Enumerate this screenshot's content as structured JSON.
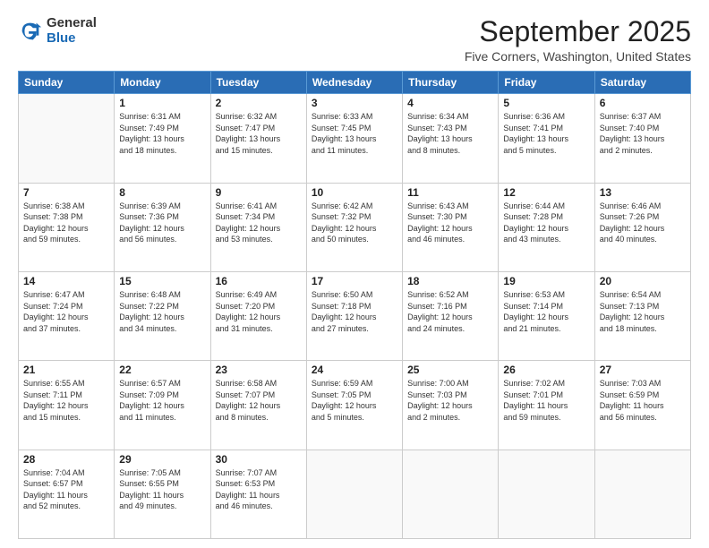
{
  "logo": {
    "general": "General",
    "blue": "Blue"
  },
  "title": {
    "month": "September 2025",
    "location": "Five Corners, Washington, United States"
  },
  "headers": [
    "Sunday",
    "Monday",
    "Tuesday",
    "Wednesday",
    "Thursday",
    "Friday",
    "Saturday"
  ],
  "weeks": [
    [
      {
        "day": "",
        "info": ""
      },
      {
        "day": "1",
        "info": "Sunrise: 6:31 AM\nSunset: 7:49 PM\nDaylight: 13 hours\nand 18 minutes."
      },
      {
        "day": "2",
        "info": "Sunrise: 6:32 AM\nSunset: 7:47 PM\nDaylight: 13 hours\nand 15 minutes."
      },
      {
        "day": "3",
        "info": "Sunrise: 6:33 AM\nSunset: 7:45 PM\nDaylight: 13 hours\nand 11 minutes."
      },
      {
        "day": "4",
        "info": "Sunrise: 6:34 AM\nSunset: 7:43 PM\nDaylight: 13 hours\nand 8 minutes."
      },
      {
        "day": "5",
        "info": "Sunrise: 6:36 AM\nSunset: 7:41 PM\nDaylight: 13 hours\nand 5 minutes."
      },
      {
        "day": "6",
        "info": "Sunrise: 6:37 AM\nSunset: 7:40 PM\nDaylight: 13 hours\nand 2 minutes."
      }
    ],
    [
      {
        "day": "7",
        "info": "Sunrise: 6:38 AM\nSunset: 7:38 PM\nDaylight: 12 hours\nand 59 minutes."
      },
      {
        "day": "8",
        "info": "Sunrise: 6:39 AM\nSunset: 7:36 PM\nDaylight: 12 hours\nand 56 minutes."
      },
      {
        "day": "9",
        "info": "Sunrise: 6:41 AM\nSunset: 7:34 PM\nDaylight: 12 hours\nand 53 minutes."
      },
      {
        "day": "10",
        "info": "Sunrise: 6:42 AM\nSunset: 7:32 PM\nDaylight: 12 hours\nand 50 minutes."
      },
      {
        "day": "11",
        "info": "Sunrise: 6:43 AM\nSunset: 7:30 PM\nDaylight: 12 hours\nand 46 minutes."
      },
      {
        "day": "12",
        "info": "Sunrise: 6:44 AM\nSunset: 7:28 PM\nDaylight: 12 hours\nand 43 minutes."
      },
      {
        "day": "13",
        "info": "Sunrise: 6:46 AM\nSunset: 7:26 PM\nDaylight: 12 hours\nand 40 minutes."
      }
    ],
    [
      {
        "day": "14",
        "info": "Sunrise: 6:47 AM\nSunset: 7:24 PM\nDaylight: 12 hours\nand 37 minutes."
      },
      {
        "day": "15",
        "info": "Sunrise: 6:48 AM\nSunset: 7:22 PM\nDaylight: 12 hours\nand 34 minutes."
      },
      {
        "day": "16",
        "info": "Sunrise: 6:49 AM\nSunset: 7:20 PM\nDaylight: 12 hours\nand 31 minutes."
      },
      {
        "day": "17",
        "info": "Sunrise: 6:50 AM\nSunset: 7:18 PM\nDaylight: 12 hours\nand 27 minutes."
      },
      {
        "day": "18",
        "info": "Sunrise: 6:52 AM\nSunset: 7:16 PM\nDaylight: 12 hours\nand 24 minutes."
      },
      {
        "day": "19",
        "info": "Sunrise: 6:53 AM\nSunset: 7:14 PM\nDaylight: 12 hours\nand 21 minutes."
      },
      {
        "day": "20",
        "info": "Sunrise: 6:54 AM\nSunset: 7:13 PM\nDaylight: 12 hours\nand 18 minutes."
      }
    ],
    [
      {
        "day": "21",
        "info": "Sunrise: 6:55 AM\nSunset: 7:11 PM\nDaylight: 12 hours\nand 15 minutes."
      },
      {
        "day": "22",
        "info": "Sunrise: 6:57 AM\nSunset: 7:09 PM\nDaylight: 12 hours\nand 11 minutes."
      },
      {
        "day": "23",
        "info": "Sunrise: 6:58 AM\nSunset: 7:07 PM\nDaylight: 12 hours\nand 8 minutes."
      },
      {
        "day": "24",
        "info": "Sunrise: 6:59 AM\nSunset: 7:05 PM\nDaylight: 12 hours\nand 5 minutes."
      },
      {
        "day": "25",
        "info": "Sunrise: 7:00 AM\nSunset: 7:03 PM\nDaylight: 12 hours\nand 2 minutes."
      },
      {
        "day": "26",
        "info": "Sunrise: 7:02 AM\nSunset: 7:01 PM\nDaylight: 11 hours\nand 59 minutes."
      },
      {
        "day": "27",
        "info": "Sunrise: 7:03 AM\nSunset: 6:59 PM\nDaylight: 11 hours\nand 56 minutes."
      }
    ],
    [
      {
        "day": "28",
        "info": "Sunrise: 7:04 AM\nSunset: 6:57 PM\nDaylight: 11 hours\nand 52 minutes."
      },
      {
        "day": "29",
        "info": "Sunrise: 7:05 AM\nSunset: 6:55 PM\nDaylight: 11 hours\nand 49 minutes."
      },
      {
        "day": "30",
        "info": "Sunrise: 7:07 AM\nSunset: 6:53 PM\nDaylight: 11 hours\nand 46 minutes."
      },
      {
        "day": "",
        "info": ""
      },
      {
        "day": "",
        "info": ""
      },
      {
        "day": "",
        "info": ""
      },
      {
        "day": "",
        "info": ""
      }
    ]
  ]
}
